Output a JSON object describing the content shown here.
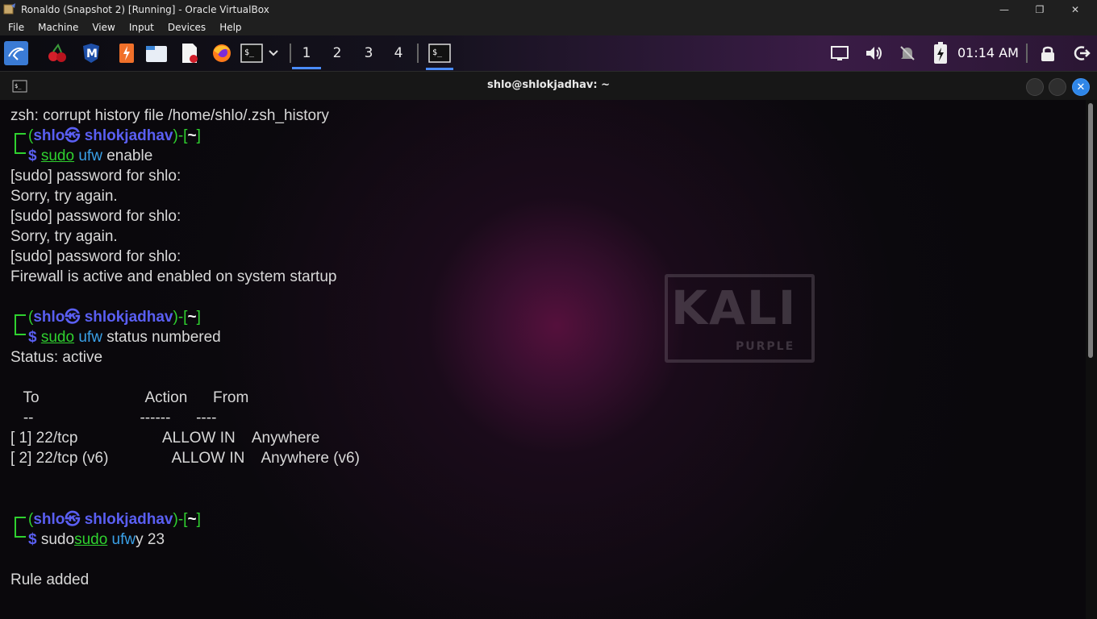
{
  "host": {
    "title": "Ronaldo (Snapshot 2) [Running] - Oracle VirtualBox",
    "menu": [
      "File",
      "Machine",
      "View",
      "Input",
      "Devices",
      "Help"
    ]
  },
  "panel": {
    "workspaces": [
      "1",
      "2",
      "3",
      "4"
    ],
    "clock": "01:14 AM"
  },
  "terminal": {
    "title": "shlo@shlokjadhav: ~",
    "prompt": {
      "user": "shlo",
      "at": "㉿",
      "host": "shlokjadhav",
      "open_bracket": "[",
      "dir": "~",
      "close_bracket": "]",
      "dollar": "$"
    },
    "lines": {
      "l1": "zsh: corrupt history file /home/shlo/.zsh_history",
      "cmd1_sudo": "sudo",
      "cmd1_ufw": "ufw",
      "cmd1_rest": " enable",
      "l3": "[sudo] password for shlo:",
      "l4": "Sorry, try again.",
      "l5": "[sudo] password for shlo:",
      "l6": "Sorry, try again.",
      "l7": "[sudo] password for shlo:",
      "l8": "Firewall is active and enabled on system startup",
      "cmd2_sudo": "sudo",
      "cmd2_ufw": "ufw",
      "cmd2_rest": " status numbered",
      "l10": "Status: active",
      "hdr": "   To                         Action      From",
      "hdr2": "   --                         ------      ----",
      "r1": "[ 1] 22/tcp                    ALLOW IN    Anywhere",
      "r2": "[ 2] 22/tcp (v6)               ALLOW IN    Anywhere (v6)",
      "cmd3_pre": "sudo",
      "cmd3_sudo": "sudo",
      "cmd3_ufw": "ufw",
      "cmd3_rest": "y 23",
      "l_last": "Rule added"
    },
    "watermark": {
      "word": "KALI",
      "sub": "PURPLE"
    }
  }
}
